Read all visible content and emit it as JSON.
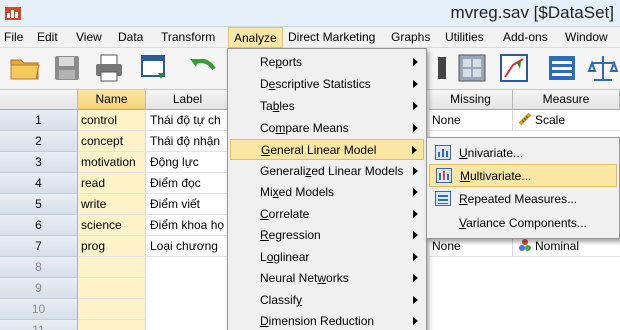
{
  "window": {
    "title": "mvreg.sav [$DataSet]"
  },
  "menubar": {
    "items": [
      "File",
      "Edit",
      "View",
      "Data",
      "Transform",
      "Analyze",
      "Direct Marketing",
      "Graphs",
      "Utilities",
      "Add-ons",
      "Window"
    ],
    "active": "Analyze"
  },
  "toolbar": {
    "icons": [
      "open-folder-icon",
      "save-icon",
      "print-icon",
      "dialog-recall-icon",
      "undo-icon",
      "variables-icon",
      "select-cases-icon",
      "value-labels-icon",
      "scale-icon"
    ]
  },
  "grid": {
    "headers": {
      "name": "Name",
      "label": "Label",
      "missing": "Missing",
      "measure": "Measure"
    },
    "rows": [
      {
        "num": "1",
        "name": "control",
        "label": "Thái độ tự ch",
        "missing": "None",
        "measure": "Scale"
      },
      {
        "num": "2",
        "name": "concept",
        "label": "Thái độ nhận",
        "missing": "",
        "measure": ""
      },
      {
        "num": "3",
        "name": "motivation",
        "label": "Động lực",
        "missing": "",
        "measure": ""
      },
      {
        "num": "4",
        "name": "read",
        "label": "Điểm đọc",
        "missing": "",
        "measure": ""
      },
      {
        "num": "5",
        "name": "write",
        "label": "Điểm viết",
        "missing": "",
        "measure": ""
      },
      {
        "num": "6",
        "name": "science",
        "label": "Điểm khoa họ",
        "missing": "",
        "measure": ""
      },
      {
        "num": "7",
        "name": "prog",
        "label": "Loại chương",
        "missing": "None",
        "measure": "Nominal"
      },
      {
        "num": "8",
        "name": "",
        "label": "",
        "missing": "",
        "measure": ""
      },
      {
        "num": "9",
        "name": "",
        "label": "",
        "missing": "",
        "measure": ""
      },
      {
        "num": "10",
        "name": "",
        "label": "",
        "missing": "",
        "measure": ""
      },
      {
        "num": "11",
        "name": "",
        "label": "",
        "missing": "",
        "measure": ""
      }
    ]
  },
  "analyze_menu": {
    "items": [
      {
        "pre": "Re",
        "key": "p",
        "post": "orts",
        "submenu": true
      },
      {
        "pre": "D",
        "key": "e",
        "post": "scriptive Statistics",
        "submenu": true
      },
      {
        "pre": "Ta",
        "key": "b",
        "post": "les",
        "submenu": true
      },
      {
        "pre": "Co",
        "key": "m",
        "post": "pare Means",
        "submenu": true
      },
      {
        "pre": "",
        "key": "G",
        "post": "eneral Linear Model",
        "submenu": true
      },
      {
        "pre": "Generali",
        "key": "z",
        "post": "ed Linear Models",
        "submenu": true
      },
      {
        "pre": "Mi",
        "key": "x",
        "post": "ed Models",
        "submenu": true
      },
      {
        "pre": "",
        "key": "C",
        "post": "orrelate",
        "submenu": true
      },
      {
        "pre": "",
        "key": "R",
        "post": "egression",
        "submenu": true
      },
      {
        "pre": "L",
        "key": "o",
        "post": "glinear",
        "submenu": true
      },
      {
        "pre": "Neural Net",
        "key": "w",
        "post": "orks",
        "submenu": true
      },
      {
        "pre": "Classif",
        "key": "y",
        "post": "",
        "submenu": true
      },
      {
        "pre": "",
        "key": "D",
        "post": "imension Reduction",
        "submenu": true
      }
    ],
    "highlighted": "General Linear Model"
  },
  "glm_submenu": {
    "items": [
      {
        "pre": "",
        "key": "U",
        "post": "nivariate...",
        "icon": "univariate-icon"
      },
      {
        "pre": "",
        "key": "M",
        "post": "ultivariate...",
        "icon": "multivariate-icon"
      },
      {
        "pre": "",
        "key": "R",
        "post": "epeated Measures...",
        "icon": "repeated-measures-icon"
      },
      {
        "pre": "",
        "key": "V",
        "post": "ariance Components...",
        "icon": ""
      }
    ],
    "highlighted": "Multivariate..."
  },
  "colors": {
    "highlight": "#fce6a4",
    "name_column": "#fef3c8",
    "row_header": "#dbe3ee"
  }
}
